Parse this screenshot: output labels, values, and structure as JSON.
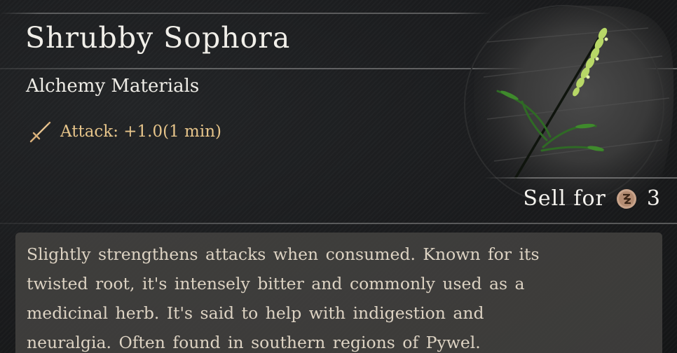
{
  "item": {
    "name": "Shrubby Sophora",
    "category": "Alchemy Materials",
    "stat": {
      "icon": "sword-icon",
      "text": "Attack: +1.0(1 min)",
      "color": "#e6c48a"
    },
    "image_icon": "sophora-plant-illustration"
  },
  "sell": {
    "label": "Sell for",
    "currency_icon": "coin-icon",
    "price": "3"
  },
  "description": {
    "lines": [
      "Slightly strengthens attacks when consumed. Known for its",
      "twisted root, it's intensely bitter and commonly used as a",
      "medicinal herb. It's said to help with indigestion and",
      "neuralgia. Often found in southern regions of Pywel."
    ]
  }
}
